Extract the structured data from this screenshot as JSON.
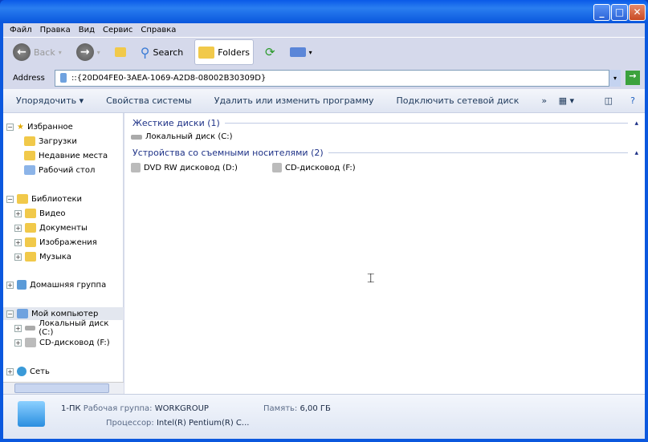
{
  "menu": [
    "Файл",
    "Правка",
    "Вид",
    "Сервис",
    "Справка"
  ],
  "toolbar": {
    "back": "Back",
    "search": "Search",
    "folders": "Folders"
  },
  "address": {
    "label": "Address",
    "value": "::{20D04FE0-3AEA-1069-A2D8-08002B30309D}"
  },
  "commands": [
    "Упорядочить ▾",
    "Свойства системы",
    "Удалить или изменить программу",
    "Подключить сетевой диск",
    "»"
  ],
  "nav": {
    "favorites": "Избранное",
    "downloads": "Загрузки",
    "recent": "Недавние места",
    "desktop": "Рабочий стол",
    "libraries": "Библиотеки",
    "video": "Видео",
    "documents": "Документы",
    "images": "Изображения",
    "music": "Музыка",
    "homegroup": "Домашняя группа",
    "computer": "Мой компьютер",
    "localdisk": "Локальный диск (C:)",
    "cd": "CD-дисковод (F:)",
    "network": "Сеть"
  },
  "groups": {
    "hdd": "Жесткие диски (1)",
    "removable": "Устройства со съемными носителями (2)"
  },
  "items": {
    "c": "Локальный диск (C:)",
    "d": "DVD RW дисковод (D:)",
    "f": "CD-дисковод (F:)"
  },
  "status": {
    "name": "1-ПК",
    "wg_label": "Рабочая группа:",
    "wg": "WORKGROUP",
    "mem_label": "Память:",
    "mem": "6,00 ГБ",
    "cpu_label": "Процессор:",
    "cpu": "Intel(R) Pentium(R) C..."
  }
}
